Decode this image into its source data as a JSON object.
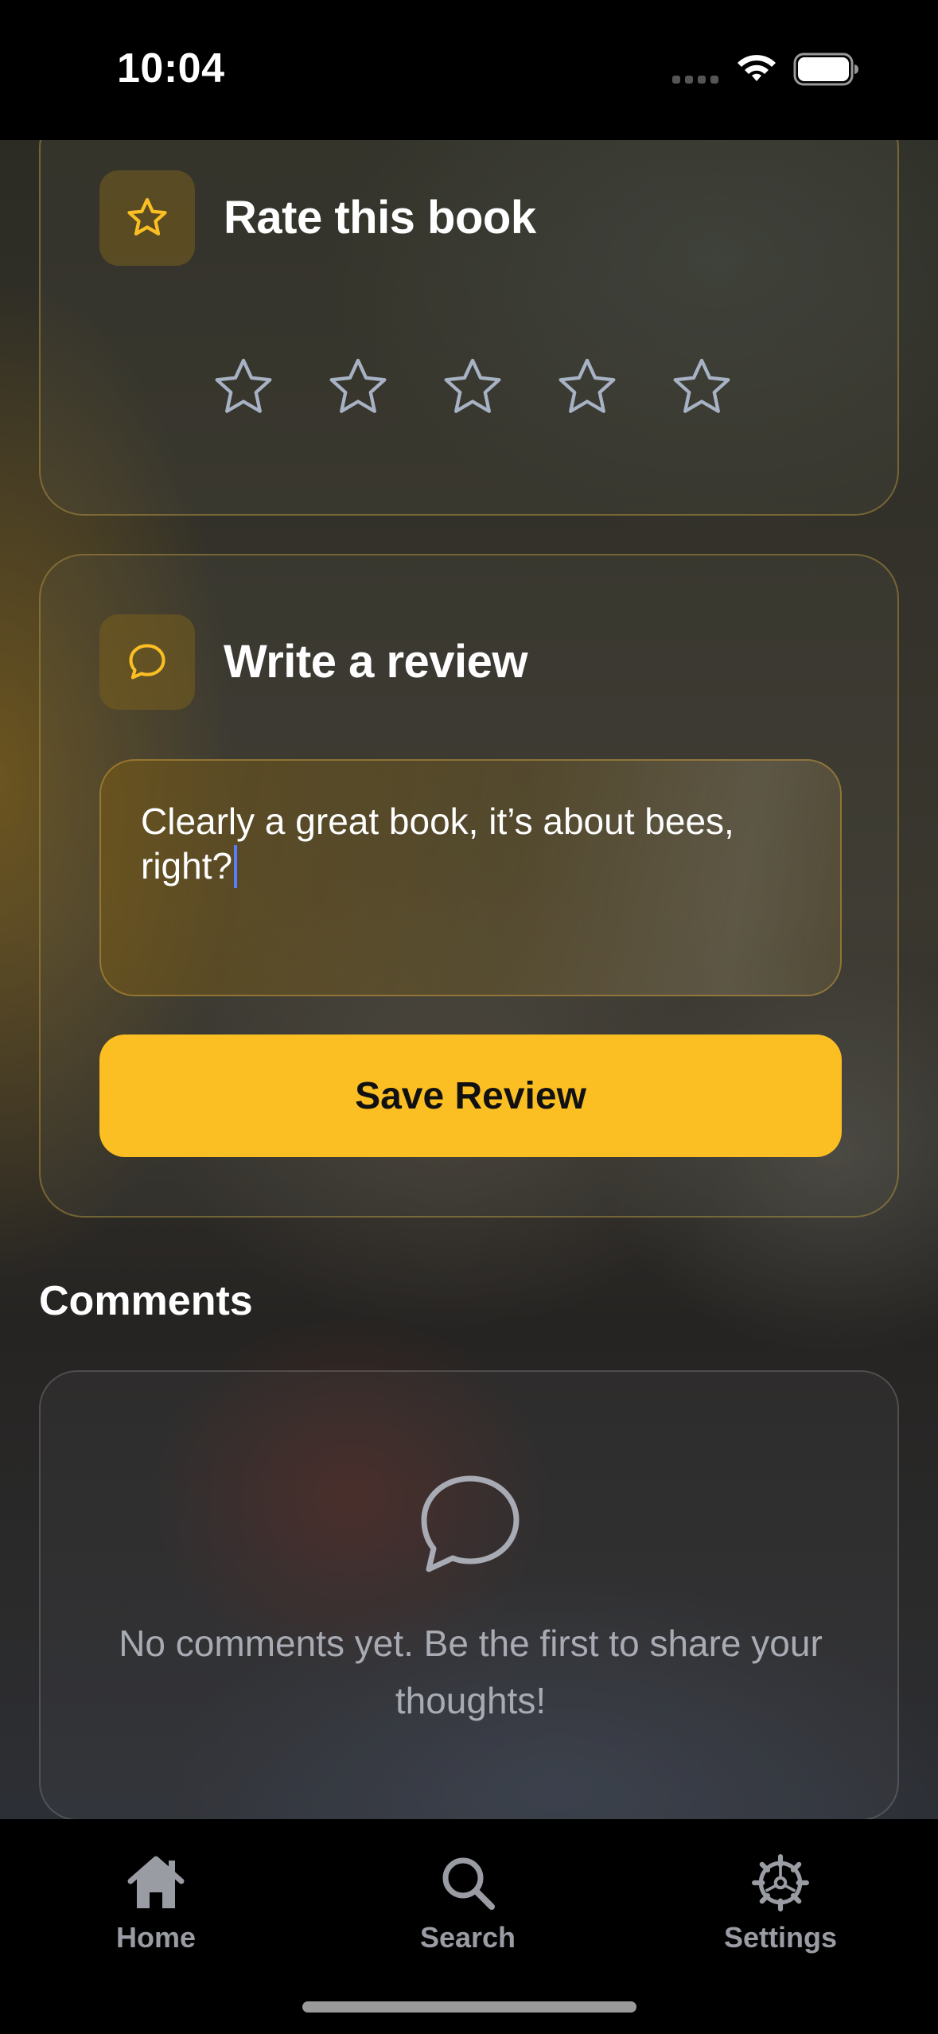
{
  "status_bar": {
    "time": "10:04"
  },
  "rate_card": {
    "title": "Rate this book",
    "icon": "star-icon",
    "rating": 0,
    "max_rating": 5,
    "accent": "#fbbf24",
    "star_outline_color": "#a7b2c4"
  },
  "review_card": {
    "title": "Write a review",
    "icon": "speech-bubble-icon",
    "review_text": "Clearly a great book, it’s about bees, right?",
    "save_label": "Save Review",
    "button_color": "#fbbf24"
  },
  "comments": {
    "title": "Comments",
    "empty_icon": "speech-bubble-icon",
    "empty_message": "No comments yet. Be the first to share your thoughts!"
  },
  "tab_bar": {
    "tabs": [
      {
        "label": "Home",
        "icon": "home-icon"
      },
      {
        "label": "Search",
        "icon": "search-icon"
      },
      {
        "label": "Settings",
        "icon": "gear-icon"
      }
    ]
  }
}
